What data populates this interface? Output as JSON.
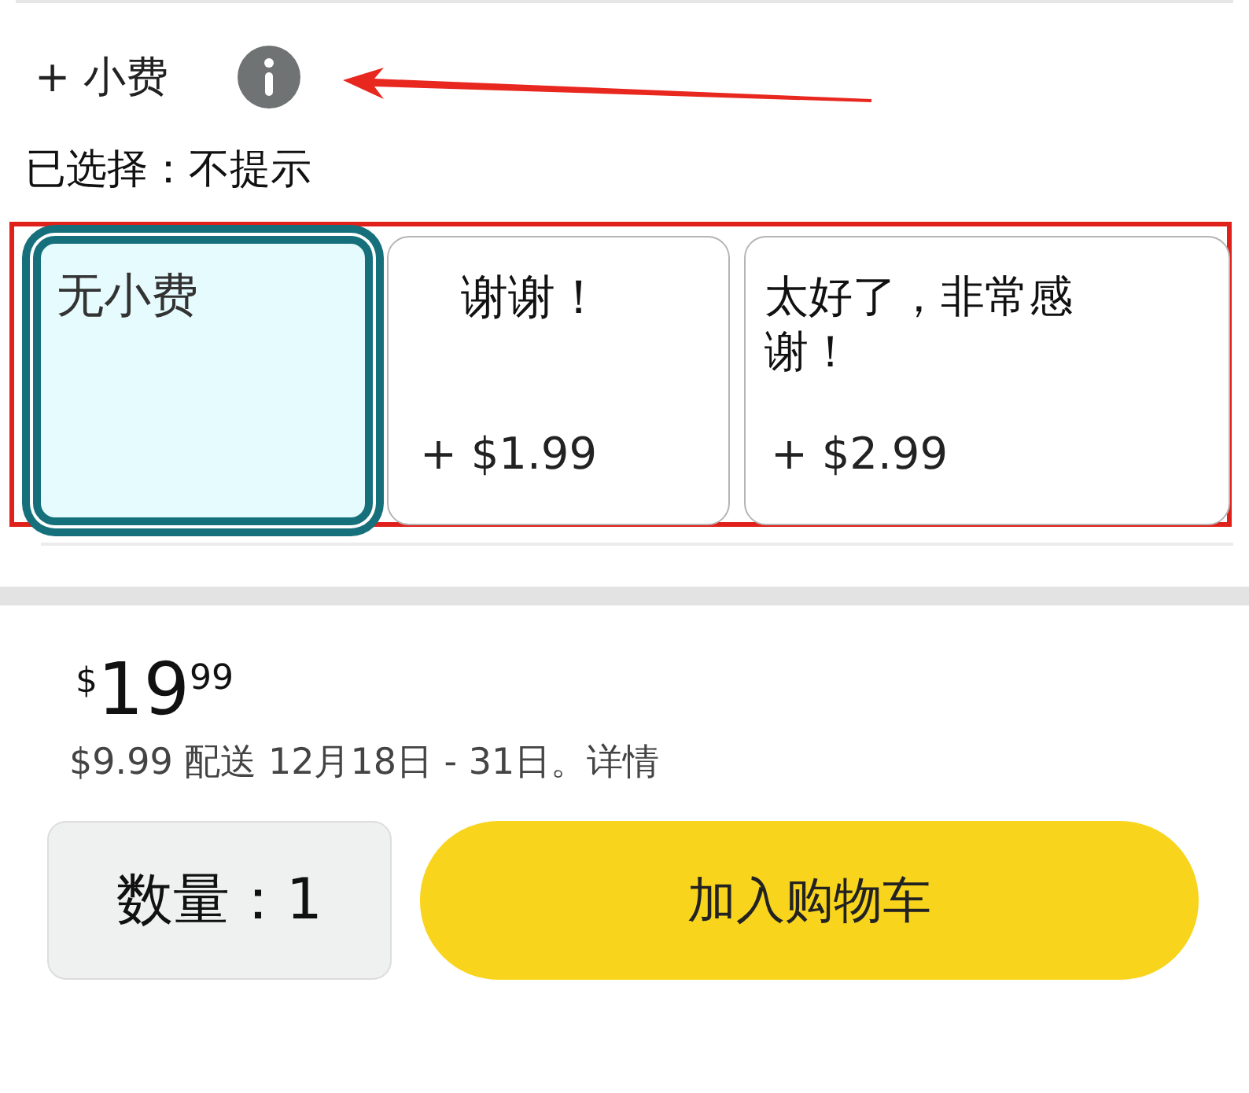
{
  "tip": {
    "label": "+ 小费"
  },
  "selection_text": "已选择：不提示",
  "options": [
    {
      "title": "无小费",
      "selected": true
    },
    {
      "title": "谢谢！",
      "amount": "+ $1.99",
      "selected": false
    },
    {
      "title": "太好了，非常感谢！",
      "amount": "+ $2.99",
      "selected": false
    }
  ],
  "price": {
    "currency": "$",
    "whole": "19",
    "fraction": "99"
  },
  "delivery": "$9.99 配送 12月18日 - 31日。详情",
  "quantity": {
    "label": "数量：1"
  },
  "add_to_cart": "加入购物车",
  "annotation_arrow": true,
  "highlight_frame": true
}
